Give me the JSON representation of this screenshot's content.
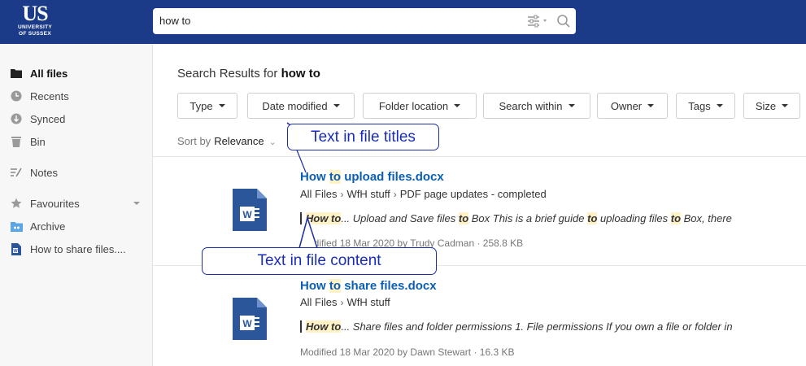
{
  "header": {
    "logo_big": "US",
    "logo_line1": "UNIVERSITY",
    "logo_line2": "OF SUSSEX",
    "search_value": "how to"
  },
  "sidebar": {
    "items": [
      {
        "label": "All files",
        "icon": "folder-icon",
        "active": true
      },
      {
        "label": "Recents",
        "icon": "clock-icon"
      },
      {
        "label": "Synced",
        "icon": "sync-icon"
      },
      {
        "label": "Bin",
        "icon": "bin-icon"
      },
      {
        "label": "Notes",
        "icon": "notes-icon"
      },
      {
        "label": "Favourites",
        "icon": "star-icon"
      },
      {
        "label": "Archive",
        "icon": "archive-icon"
      },
      {
        "label": "How to share files....",
        "icon": "word-doc-icon"
      }
    ]
  },
  "main": {
    "results_prefix": "Search Results for",
    "results_query": "how to",
    "filters": [
      "Type",
      "Date modified",
      "Folder location",
      "Search within",
      "Owner",
      "Tags",
      "Size"
    ],
    "sort_label": "Sort by",
    "sort_value": "Relevance"
  },
  "results": [
    {
      "title_hl1": "How",
      "title_hl2": "to",
      "title_rest": "upload files.docx",
      "path": [
        "All Files",
        "WfH stuff",
        "PDF page updates - completed"
      ],
      "snippet": {
        "hl1": "How to",
        "t1": "... Upload and Save files ",
        "hl2": "to",
        "t2": " Box   This is a brief guide ",
        "hl3": "to",
        "t3": " uploading files ",
        "hl4": "to",
        "t4": " Box, there"
      },
      "meta": "Modified 18 Mar 2020 by Trudy Cadman  ·  258.8 KB"
    },
    {
      "title_hl1": "How",
      "title_hl2": "to",
      "title_rest": "share files.docx",
      "path": [
        "All Files",
        "WfH stuff"
      ],
      "snippet": {
        "hl1": "How to",
        "t1": "... Share files and folder permissions 1. File permissions If you own a file or folder in"
      },
      "meta": "Modified 18 Mar 2020 by Dawn Stewart  ·  16.3 KB"
    }
  ],
  "annotations": {
    "titles_callout": "Text in file titles",
    "content_callout": "Text in file content"
  },
  "colors": {
    "header_bg": "#1b3a87",
    "link_blue": "#0a5fb5",
    "highlight": "#fff2c6",
    "callout_text": "#1a2db8",
    "word_blue": "#2b579a"
  }
}
